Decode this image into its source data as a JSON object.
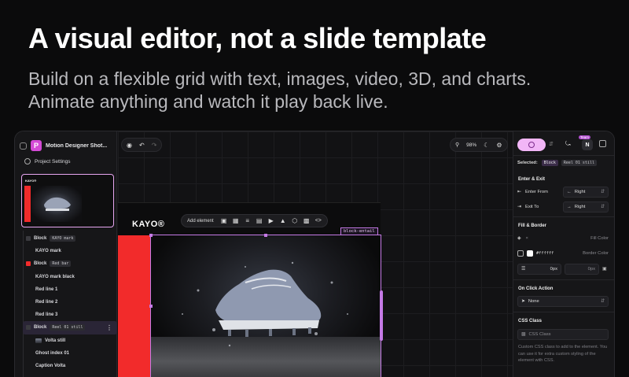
{
  "headline": "A visual editor, not a slide template",
  "subline": "Build on a flexible grid with text, images, video, 3D, and charts. Animate anything and watch it play back live.",
  "colors": {
    "accent": "#c57ae6",
    "brand_red": "#f22b2b",
    "play_button": "#f2b6f7"
  },
  "left_panel": {
    "project_icon_letter": "P",
    "project_name": "Motion Designer Shot...",
    "project_settings": "Project Settings",
    "thumb_logo": "KAYO®",
    "layers": [
      {
        "name": "Block",
        "tag": "KAYO mark",
        "swatch": "#3a3a3f",
        "indent": false,
        "selected": false
      },
      {
        "name": "KAYO mark",
        "tag": "",
        "swatch": "",
        "indent": true,
        "selected": false
      },
      {
        "name": "Block",
        "tag": "Red bar",
        "swatch": "#f22b2b",
        "indent": false,
        "selected": false
      },
      {
        "name": "KAYO mark black",
        "tag": "",
        "swatch": "",
        "indent": true,
        "selected": false
      },
      {
        "name": "Red line 1",
        "tag": "",
        "swatch": "",
        "indent": true,
        "selected": false
      },
      {
        "name": "Red line 2",
        "tag": "",
        "swatch": "",
        "indent": true,
        "selected": false
      },
      {
        "name": "Red line 3",
        "tag": "",
        "swatch": "",
        "indent": true,
        "selected": false
      },
      {
        "name": "Block",
        "tag": "Reel 01 still",
        "swatch": "",
        "indent": false,
        "selected": true
      },
      {
        "name": "Volta still",
        "tag": "",
        "swatch": "",
        "indent": true,
        "selected": false
      },
      {
        "name": "Ghost index 01",
        "tag": "",
        "swatch": "",
        "indent": true,
        "selected": false
      },
      {
        "name": "Caption Volta",
        "tag": "",
        "swatch": "",
        "indent": true,
        "selected": false
      }
    ]
  },
  "canvas": {
    "zoom": "98%",
    "add_element_label": "Add element",
    "kayo_logo": "KAYO®",
    "block_label": "block-entail"
  },
  "right_panel": {
    "team_badge": "Team",
    "avatar_letter": "N",
    "selected_label": "Selected:",
    "selected_block": "Block",
    "selected_name": "Reel 01 still",
    "enter_exit_title": "Enter & Exit",
    "enter_from_label": "Enter From",
    "enter_from_value": "Right",
    "exit_to_label": "Exit To",
    "exit_to_value": "Right",
    "fill_border_title": "Fill & Border",
    "fill_color_label": "Fill Color",
    "border_hex": "#ffffff",
    "border_color_label": "Border Color",
    "radius_value": "0px",
    "border_width_value": "0px",
    "on_click_title": "On Click Action",
    "on_click_value": "None",
    "css_class_title": "CSS Class",
    "css_class_placeholder": "CSS Class",
    "css_class_help": "Custom CSS class to add to the element. You can use it for extra custom styling of the element with CSS."
  }
}
